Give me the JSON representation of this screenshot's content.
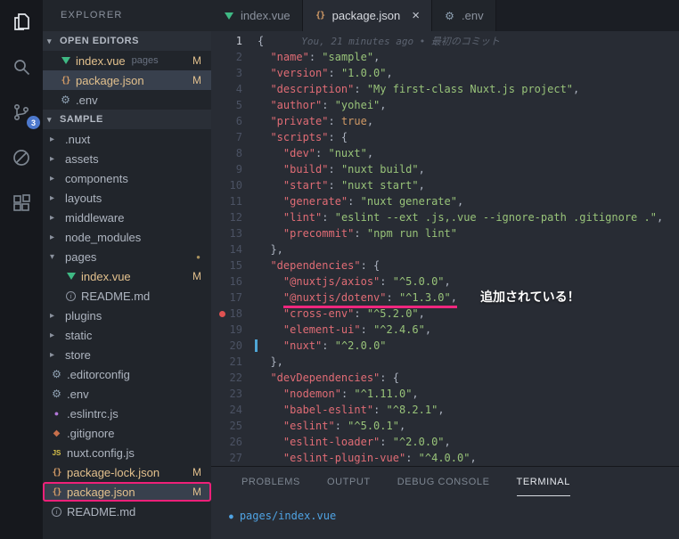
{
  "colors": {
    "annotation_pink": "#f0267e",
    "badge_blue": "#4d78cc",
    "git_modified": "#e2c08d",
    "json_key": "#e06c75",
    "json_string": "#98c379"
  },
  "activity_bar": {
    "source_control_badge": "3",
    "icons": [
      "files-icon",
      "search-icon",
      "source-control-icon",
      "debug-icon",
      "extensions-icon"
    ]
  },
  "sidebar": {
    "title": "EXPLORER",
    "open_editors": {
      "label": "OPEN EDITORS",
      "items": [
        {
          "name": "index.vue",
          "detail": "pages",
          "icon": "vue-icon",
          "badge": "M",
          "modified": true,
          "selected": false
        },
        {
          "name": "package.json",
          "detail": "",
          "icon": "json-icon",
          "badge": "M",
          "modified": true,
          "selected": true
        },
        {
          "name": ".env",
          "detail": "",
          "icon": "gear-icon",
          "badge": "",
          "modified": false,
          "selected": false
        }
      ]
    },
    "project": {
      "label": "SAMPLE",
      "items": [
        {
          "name": ".nuxt",
          "kind": "folder",
          "depth": 0
        },
        {
          "name": "assets",
          "kind": "folder",
          "depth": 0
        },
        {
          "name": "components",
          "kind": "folder",
          "depth": 0
        },
        {
          "name": "layouts",
          "kind": "folder",
          "depth": 0
        },
        {
          "name": "middleware",
          "kind": "folder",
          "depth": 0
        },
        {
          "name": "node_modules",
          "kind": "folder",
          "depth": 0
        },
        {
          "name": "pages",
          "kind": "folder",
          "depth": 0,
          "expanded": true,
          "dot": true
        },
        {
          "name": "index.vue",
          "kind": "file",
          "icon": "vue-icon",
          "depth": 1,
          "badge": "M",
          "modified": true
        },
        {
          "name": "README.md",
          "kind": "file",
          "icon": "info-icon",
          "depth": 1
        },
        {
          "name": "plugins",
          "kind": "folder",
          "depth": 0
        },
        {
          "name": "static",
          "kind": "folder",
          "depth": 0
        },
        {
          "name": "store",
          "kind": "folder",
          "depth": 0
        },
        {
          "name": ".editorconfig",
          "kind": "file",
          "icon": "gear-icon",
          "depth": 0
        },
        {
          "name": ".env",
          "kind": "file",
          "icon": "gear-icon",
          "depth": 0
        },
        {
          "name": ".eslintrc.js",
          "kind": "file",
          "icon": "eslint-icon",
          "depth": 0
        },
        {
          "name": ".gitignore",
          "kind": "file",
          "icon": "git-icon",
          "depth": 0
        },
        {
          "name": "nuxt.config.js",
          "kind": "file",
          "icon": "js-icon",
          "depth": 0
        },
        {
          "name": "package-lock.json",
          "kind": "file",
          "icon": "json-icon",
          "depth": 0,
          "badge": "M",
          "modified": true
        },
        {
          "name": "package.json",
          "kind": "file",
          "icon": "json-icon",
          "depth": 0,
          "badge": "M",
          "modified": true,
          "selected": true,
          "annotated": true
        },
        {
          "name": "README.md",
          "kind": "file",
          "icon": "info-icon",
          "depth": 0
        }
      ]
    }
  },
  "tabs": [
    {
      "label": "index.vue",
      "icon": "vue-icon",
      "active": false,
      "close": false
    },
    {
      "label": "package.json",
      "icon": "json-icon",
      "active": true,
      "close": true,
      "close_glyph": "×"
    },
    {
      "label": ".env",
      "icon": "gear-icon",
      "active": false,
      "close": false
    }
  ],
  "editor": {
    "blame": "You, 21 minutes ago • 最初のコミット",
    "lines": [
      {
        "n": 1,
        "indent": 0,
        "tokens": [
          [
            "pu",
            "{"
          ]
        ],
        "blame": true,
        "active": true
      },
      {
        "n": 2,
        "indent": 2,
        "tokens": [
          [
            "k",
            "\"name\""
          ],
          [
            "pu",
            ": "
          ],
          [
            "s",
            "\"sample\""
          ],
          [
            "pu",
            ","
          ]
        ]
      },
      {
        "n": 3,
        "indent": 2,
        "tokens": [
          [
            "k",
            "\"version\""
          ],
          [
            "pu",
            ": "
          ],
          [
            "s",
            "\"1.0.0\""
          ],
          [
            "pu",
            ","
          ]
        ]
      },
      {
        "n": 4,
        "indent": 2,
        "tokens": [
          [
            "k",
            "\"description\""
          ],
          [
            "pu",
            ": "
          ],
          [
            "s",
            "\"My first-class Nuxt.js project\""
          ],
          [
            "pu",
            ","
          ]
        ]
      },
      {
        "n": 5,
        "indent": 2,
        "tokens": [
          [
            "k",
            "\"author\""
          ],
          [
            "pu",
            ": "
          ],
          [
            "s",
            "\"yohei\""
          ],
          [
            "pu",
            ","
          ]
        ]
      },
      {
        "n": 6,
        "indent": 2,
        "tokens": [
          [
            "k",
            "\"private\""
          ],
          [
            "pu",
            ": "
          ],
          [
            "kw",
            "true"
          ],
          [
            "pu",
            ","
          ]
        ]
      },
      {
        "n": 7,
        "indent": 2,
        "tokens": [
          [
            "k",
            "\"scripts\""
          ],
          [
            "pu",
            ": {"
          ]
        ]
      },
      {
        "n": 8,
        "indent": 4,
        "tokens": [
          [
            "k",
            "\"dev\""
          ],
          [
            "pu",
            ": "
          ],
          [
            "s",
            "\"nuxt\""
          ],
          [
            "pu",
            ","
          ]
        ]
      },
      {
        "n": 9,
        "indent": 4,
        "tokens": [
          [
            "k",
            "\"build\""
          ],
          [
            "pu",
            ": "
          ],
          [
            "s",
            "\"nuxt build\""
          ],
          [
            "pu",
            ","
          ]
        ]
      },
      {
        "n": 10,
        "indent": 4,
        "tokens": [
          [
            "k",
            "\"start\""
          ],
          [
            "pu",
            ": "
          ],
          [
            "s",
            "\"nuxt start\""
          ],
          [
            "pu",
            ","
          ]
        ]
      },
      {
        "n": 11,
        "indent": 4,
        "tokens": [
          [
            "k",
            "\"generate\""
          ],
          [
            "pu",
            ": "
          ],
          [
            "s",
            "\"nuxt generate\""
          ],
          [
            "pu",
            ","
          ]
        ]
      },
      {
        "n": 12,
        "indent": 4,
        "tokens": [
          [
            "k",
            "\"lint\""
          ],
          [
            "pu",
            ": "
          ],
          [
            "s",
            "\"eslint --ext .js,.vue --ignore-path .gitignore .\""
          ],
          [
            "pu",
            ","
          ]
        ]
      },
      {
        "n": 13,
        "indent": 4,
        "tokens": [
          [
            "k",
            "\"precommit\""
          ],
          [
            "pu",
            ": "
          ],
          [
            "s",
            "\"npm run lint\""
          ]
        ]
      },
      {
        "n": 14,
        "indent": 2,
        "tokens": [
          [
            "pu",
            "},"
          ]
        ]
      },
      {
        "n": 15,
        "indent": 2,
        "tokens": [
          [
            "k",
            "\"dependencies\""
          ],
          [
            "pu",
            ": {"
          ]
        ]
      },
      {
        "n": 16,
        "indent": 4,
        "tokens": [
          [
            "k",
            "\"@nuxtjs/axios\""
          ],
          [
            "pu",
            ": "
          ],
          [
            "s",
            "\"^5.0.0\""
          ],
          [
            "pu",
            ","
          ]
        ]
      },
      {
        "n": 17,
        "indent": 4,
        "tokens": [
          [
            "k",
            "\"@nuxtjs/dotenv\""
          ],
          [
            "pu",
            ": "
          ],
          [
            "s",
            "\"^1.3.0\""
          ],
          [
            "pu",
            ","
          ]
        ],
        "underline": true,
        "callout": true
      },
      {
        "n": 18,
        "indent": 4,
        "tokens": [
          [
            "k",
            "\"cross-env\""
          ],
          [
            "pu",
            ": "
          ],
          [
            "s",
            "\"^5.2.0\""
          ],
          [
            "pu",
            ","
          ]
        ],
        "marker": "red-dot"
      },
      {
        "n": 19,
        "indent": 4,
        "tokens": [
          [
            "k",
            "\"element-ui\""
          ],
          [
            "pu",
            ": "
          ],
          [
            "s",
            "\"^2.4.6\""
          ],
          [
            "pu",
            ","
          ]
        ]
      },
      {
        "n": 20,
        "indent": 4,
        "tokens": [
          [
            "k",
            "\"nuxt\""
          ],
          [
            "pu",
            ": "
          ],
          [
            "s",
            "\"^2.0.0\""
          ]
        ],
        "marker": "blue-bar"
      },
      {
        "n": 21,
        "indent": 2,
        "tokens": [
          [
            "pu",
            "},"
          ]
        ]
      },
      {
        "n": 22,
        "indent": 2,
        "tokens": [
          [
            "k",
            "\"devDependencies\""
          ],
          [
            "pu",
            ": {"
          ]
        ]
      },
      {
        "n": 23,
        "indent": 4,
        "tokens": [
          [
            "k",
            "\"nodemon\""
          ],
          [
            "pu",
            ": "
          ],
          [
            "s",
            "\"^1.11.0\""
          ],
          [
            "pu",
            ","
          ]
        ]
      },
      {
        "n": 24,
        "indent": 4,
        "tokens": [
          [
            "k",
            "\"babel-eslint\""
          ],
          [
            "pu",
            ": "
          ],
          [
            "s",
            "\"^8.2.1\""
          ],
          [
            "pu",
            ","
          ]
        ]
      },
      {
        "n": 25,
        "indent": 4,
        "tokens": [
          [
            "k",
            "\"eslint\""
          ],
          [
            "pu",
            ": "
          ],
          [
            "s",
            "\"^5.0.1\""
          ],
          [
            "pu",
            ","
          ]
        ]
      },
      {
        "n": 26,
        "indent": 4,
        "tokens": [
          [
            "k",
            "\"eslint-loader\""
          ],
          [
            "pu",
            ": "
          ],
          [
            "s",
            "\"^2.0.0\""
          ],
          [
            "pu",
            ","
          ]
        ]
      },
      {
        "n": 27,
        "indent": 4,
        "tokens": [
          [
            "k",
            "\"eslint-plugin-vue\""
          ],
          [
            "pu",
            ": "
          ],
          [
            "s",
            "\"^4.0.0\""
          ],
          [
            "pu",
            ","
          ]
        ]
      }
    ]
  },
  "annotations": {
    "label": "追加されている！"
  },
  "panel": {
    "tabs": [
      {
        "label": "PROBLEMS",
        "active": false
      },
      {
        "label": "OUTPUT",
        "active": false
      },
      {
        "label": "DEBUG CONSOLE",
        "active": false
      },
      {
        "label": "TERMINAL",
        "active": true
      }
    ],
    "terminal": {
      "prefix": "●",
      "text": "pages/index.vue"
    }
  }
}
